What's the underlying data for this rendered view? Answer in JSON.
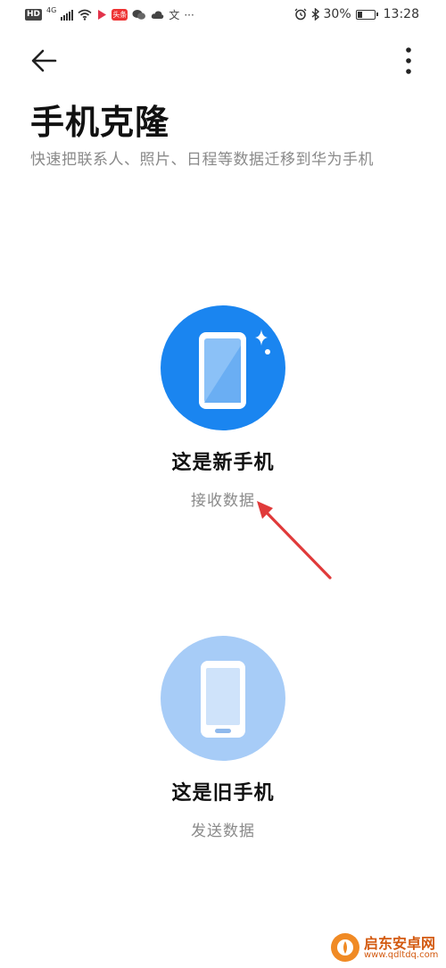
{
  "status_bar": {
    "hd": "HD",
    "network": "4G",
    "toutiao": "头条",
    "battery": "30%",
    "battery_level": 0.3,
    "time": "13:28"
  },
  "header": {
    "title": "手机克隆",
    "subtitle": "快速把联系人、照片、日程等数据迁移到华为手机"
  },
  "options": [
    {
      "title": "这是新手机",
      "subtitle": "接收数据",
      "circle_color": "#1a85f0",
      "icon": "phone-with-sparkle-icon"
    },
    {
      "title": "这是旧手机",
      "subtitle": "发送数据",
      "circle_color": "#a7ccf7",
      "icon": "phone-icon"
    }
  ],
  "annotation_color": "#e03a3a",
  "watermark": {
    "name": "启东安卓网",
    "url": "www.qdltdq.com"
  }
}
